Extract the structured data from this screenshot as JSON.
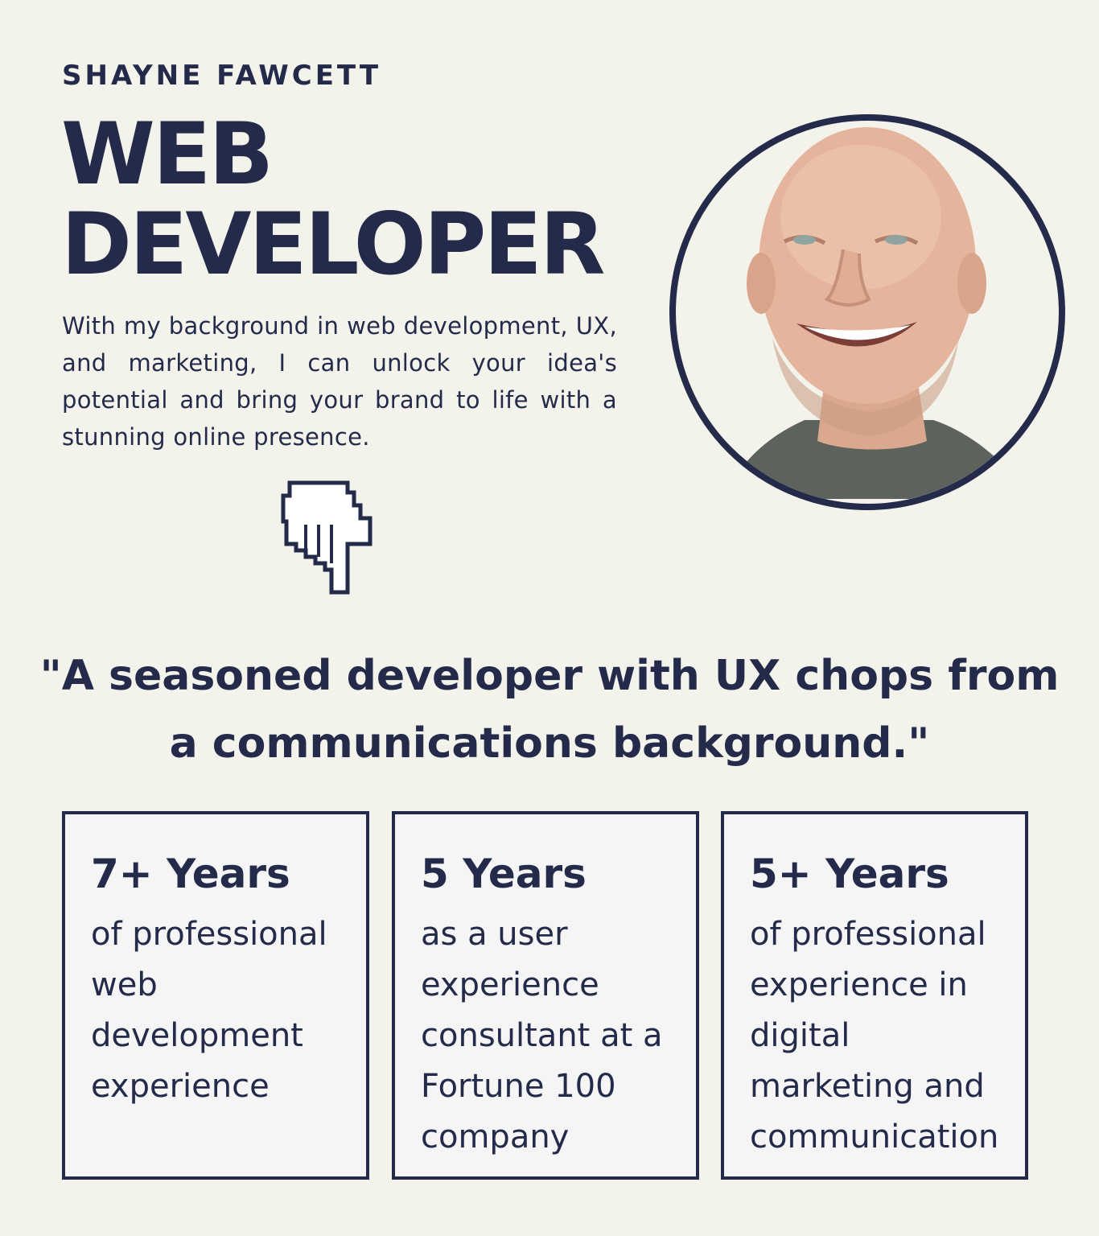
{
  "profile": {
    "name": "SHAYNE FAWCETT",
    "title_line1": "WEB",
    "title_line2": "DEVELOPER",
    "intro": "With my background in web development, UX, and marketing, I can unlock your idea's potential and bring your brand to life with a stunning online presence.",
    "photo_icon": "portrait-photo",
    "pointer_icon": "pointing-hand-icon"
  },
  "quote": "\"A seasoned developer with UX chops from a communications background.\"",
  "stats": [
    {
      "title": "7+ Years",
      "description": "of professional web development experience"
    },
    {
      "title": "5 Years",
      "description": "as a user experience consultant at a Fortune 100 company"
    },
    {
      "title": "5+ Years",
      "description": "of professional experience in digital marketing and communication"
    }
  ],
  "colors": {
    "background": "#f3f2eb",
    "text": "#232a4a",
    "card_background": "#f5f5f5"
  }
}
